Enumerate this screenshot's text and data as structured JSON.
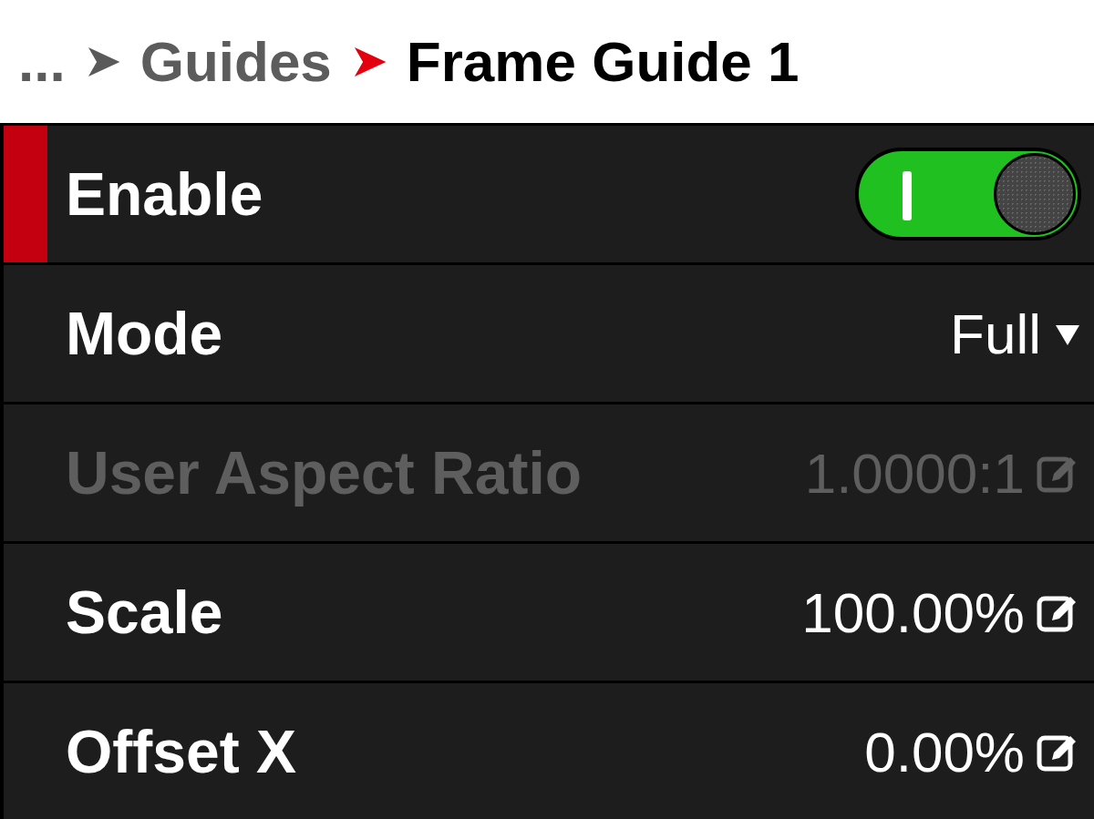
{
  "breadcrumb": [
    {
      "text": "...",
      "kind": "ellipsis"
    },
    {
      "text": "Guides",
      "kind": "parent"
    },
    {
      "text": "Frame Guide 1",
      "kind": "current"
    }
  ],
  "rows": [
    {
      "label": "Enable",
      "kind": "toggle",
      "on": true,
      "selected": true,
      "disabled": false
    },
    {
      "label": "Mode",
      "kind": "dropdown",
      "value": "Full",
      "selected": false,
      "disabled": false
    },
    {
      "label": "User Aspect Ratio",
      "kind": "edit",
      "value": "1.0000:1",
      "selected": false,
      "disabled": true
    },
    {
      "label": "Scale",
      "kind": "edit",
      "value": "100.00%",
      "selected": false,
      "disabled": false
    },
    {
      "label": "Offset X",
      "kind": "edit",
      "value": "0.00%",
      "selected": false,
      "disabled": false
    }
  ]
}
